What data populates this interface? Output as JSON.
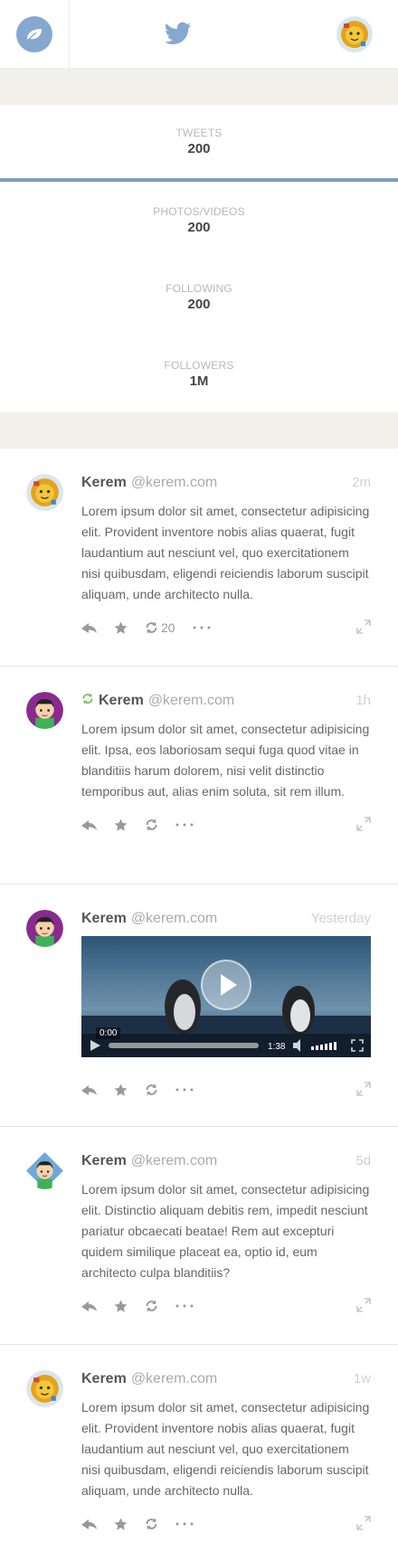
{
  "stats": [
    {
      "label": "TWEETS",
      "value": "200"
    },
    {
      "label": "PHOTOS/VIDEOS",
      "value": "200"
    },
    {
      "label": "FOLLOWING",
      "value": "200"
    },
    {
      "label": "FOLLOWERS",
      "value": "1M"
    }
  ],
  "active_stat": "TWEETS",
  "colors": {
    "accent": "#7d9fc6",
    "band": "#f2f0eb",
    "retweet_green": "#7bc35d"
  },
  "tweets": [
    {
      "name": "Kerem",
      "handle": "@kerem.com",
      "time": "2m",
      "avatar": "lion-avatar",
      "text": "Lorem ipsum dolor sit amet, consectetur adipisicing elit. Provident inventore nobis alias quaerat, fugit laudantium aut nesciunt vel, quo exercitationem nisi quibusdam, eligendi reiciendis laborum suscipit aliquam, unde architecto nulla.",
      "retweet_count": "20"
    },
    {
      "name": "Kerem",
      "handle": "@kerem.com",
      "time": "1h",
      "avatar": "boy-purple-avatar",
      "retweeted": true,
      "text": "Lorem ipsum dolor sit amet, consectetur adipisicing elit. Ipsa, eos laboriosam sequi fuga quod vitae in blanditiis harum dolorem, nisi velit distinctio temporibus aut, alias enim soluta, sit rem illum."
    },
    {
      "name": "Kerem",
      "handle": "@kerem.com",
      "time": "Yesterday",
      "avatar": "boy-purple-avatar",
      "video": {
        "current_time": "0:00",
        "duration": "1:38"
      }
    },
    {
      "name": "Kerem",
      "handle": "@kerem.com",
      "time": "5d",
      "avatar": "boy-blue-avatar",
      "text": "Lorem ipsum dolor sit amet, consectetur adipisicing elit. Distinctio aliquam debitis rem, impedit nesciunt pariatur obcaecati beatae! Rem aut excepturi quidem similique placeat ea, optio id, eum architecto culpa blanditiis?"
    },
    {
      "name": "Kerem",
      "handle": "@kerem.com",
      "time": "1w",
      "avatar": "lion-avatar",
      "text": "Lorem ipsum dolor sit amet, consectetur adipisicing elit. Provident inventore nobis alias quaerat, fugit laudantium aut nesciunt vel, quo exercitationem nisi quibusdam, eligendi reiciendis laborum suscipit aliquam, unde architecto nulla."
    }
  ]
}
